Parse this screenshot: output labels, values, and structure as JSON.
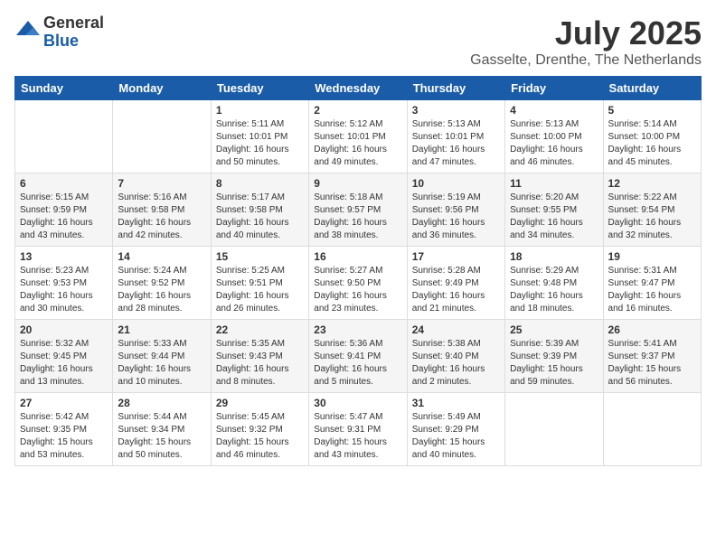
{
  "logo": {
    "general": "General",
    "blue": "Blue"
  },
  "header": {
    "month": "July 2025",
    "location": "Gasselte, Drenthe, The Netherlands"
  },
  "weekdays": [
    "Sunday",
    "Monday",
    "Tuesday",
    "Wednesday",
    "Thursday",
    "Friday",
    "Saturday"
  ],
  "weeks": [
    [
      {
        "day": "",
        "info": ""
      },
      {
        "day": "",
        "info": ""
      },
      {
        "day": "1",
        "info": "Sunrise: 5:11 AM\nSunset: 10:01 PM\nDaylight: 16 hours\nand 50 minutes."
      },
      {
        "day": "2",
        "info": "Sunrise: 5:12 AM\nSunset: 10:01 PM\nDaylight: 16 hours\nand 49 minutes."
      },
      {
        "day": "3",
        "info": "Sunrise: 5:13 AM\nSunset: 10:01 PM\nDaylight: 16 hours\nand 47 minutes."
      },
      {
        "day": "4",
        "info": "Sunrise: 5:13 AM\nSunset: 10:00 PM\nDaylight: 16 hours\nand 46 minutes."
      },
      {
        "day": "5",
        "info": "Sunrise: 5:14 AM\nSunset: 10:00 PM\nDaylight: 16 hours\nand 45 minutes."
      }
    ],
    [
      {
        "day": "6",
        "info": "Sunrise: 5:15 AM\nSunset: 9:59 PM\nDaylight: 16 hours\nand 43 minutes."
      },
      {
        "day": "7",
        "info": "Sunrise: 5:16 AM\nSunset: 9:58 PM\nDaylight: 16 hours\nand 42 minutes."
      },
      {
        "day": "8",
        "info": "Sunrise: 5:17 AM\nSunset: 9:58 PM\nDaylight: 16 hours\nand 40 minutes."
      },
      {
        "day": "9",
        "info": "Sunrise: 5:18 AM\nSunset: 9:57 PM\nDaylight: 16 hours\nand 38 minutes."
      },
      {
        "day": "10",
        "info": "Sunrise: 5:19 AM\nSunset: 9:56 PM\nDaylight: 16 hours\nand 36 minutes."
      },
      {
        "day": "11",
        "info": "Sunrise: 5:20 AM\nSunset: 9:55 PM\nDaylight: 16 hours\nand 34 minutes."
      },
      {
        "day": "12",
        "info": "Sunrise: 5:22 AM\nSunset: 9:54 PM\nDaylight: 16 hours\nand 32 minutes."
      }
    ],
    [
      {
        "day": "13",
        "info": "Sunrise: 5:23 AM\nSunset: 9:53 PM\nDaylight: 16 hours\nand 30 minutes."
      },
      {
        "day": "14",
        "info": "Sunrise: 5:24 AM\nSunset: 9:52 PM\nDaylight: 16 hours\nand 28 minutes."
      },
      {
        "day": "15",
        "info": "Sunrise: 5:25 AM\nSunset: 9:51 PM\nDaylight: 16 hours\nand 26 minutes."
      },
      {
        "day": "16",
        "info": "Sunrise: 5:27 AM\nSunset: 9:50 PM\nDaylight: 16 hours\nand 23 minutes."
      },
      {
        "day": "17",
        "info": "Sunrise: 5:28 AM\nSunset: 9:49 PM\nDaylight: 16 hours\nand 21 minutes."
      },
      {
        "day": "18",
        "info": "Sunrise: 5:29 AM\nSunset: 9:48 PM\nDaylight: 16 hours\nand 18 minutes."
      },
      {
        "day": "19",
        "info": "Sunrise: 5:31 AM\nSunset: 9:47 PM\nDaylight: 16 hours\nand 16 minutes."
      }
    ],
    [
      {
        "day": "20",
        "info": "Sunrise: 5:32 AM\nSunset: 9:45 PM\nDaylight: 16 hours\nand 13 minutes."
      },
      {
        "day": "21",
        "info": "Sunrise: 5:33 AM\nSunset: 9:44 PM\nDaylight: 16 hours\nand 10 minutes."
      },
      {
        "day": "22",
        "info": "Sunrise: 5:35 AM\nSunset: 9:43 PM\nDaylight: 16 hours\nand 8 minutes."
      },
      {
        "day": "23",
        "info": "Sunrise: 5:36 AM\nSunset: 9:41 PM\nDaylight: 16 hours\nand 5 minutes."
      },
      {
        "day": "24",
        "info": "Sunrise: 5:38 AM\nSunset: 9:40 PM\nDaylight: 16 hours\nand 2 minutes."
      },
      {
        "day": "25",
        "info": "Sunrise: 5:39 AM\nSunset: 9:39 PM\nDaylight: 15 hours\nand 59 minutes."
      },
      {
        "day": "26",
        "info": "Sunrise: 5:41 AM\nSunset: 9:37 PM\nDaylight: 15 hours\nand 56 minutes."
      }
    ],
    [
      {
        "day": "27",
        "info": "Sunrise: 5:42 AM\nSunset: 9:35 PM\nDaylight: 15 hours\nand 53 minutes."
      },
      {
        "day": "28",
        "info": "Sunrise: 5:44 AM\nSunset: 9:34 PM\nDaylight: 15 hours\nand 50 minutes."
      },
      {
        "day": "29",
        "info": "Sunrise: 5:45 AM\nSunset: 9:32 PM\nDaylight: 15 hours\nand 46 minutes."
      },
      {
        "day": "30",
        "info": "Sunrise: 5:47 AM\nSunset: 9:31 PM\nDaylight: 15 hours\nand 43 minutes."
      },
      {
        "day": "31",
        "info": "Sunrise: 5:49 AM\nSunset: 9:29 PM\nDaylight: 15 hours\nand 40 minutes."
      },
      {
        "day": "",
        "info": ""
      },
      {
        "day": "",
        "info": ""
      }
    ]
  ]
}
